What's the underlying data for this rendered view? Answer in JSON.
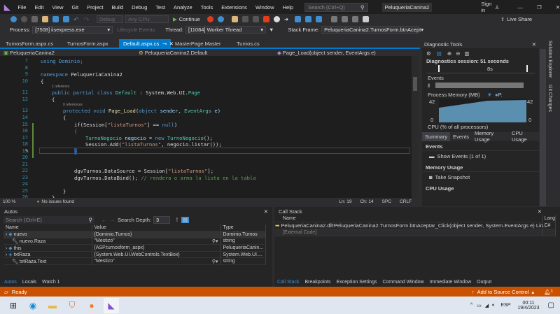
{
  "menu": {
    "items": [
      "File",
      "Edit",
      "View",
      "Git",
      "Project",
      "Build",
      "Debug",
      "Test",
      "Analyze",
      "Tools",
      "Extensions",
      "Window",
      "Help"
    ],
    "search_placeholder": "Search (Ctrl+Q)",
    "solution_title": "PeluqueriaCanina2",
    "sign_in": "Sign in"
  },
  "toolbar": {
    "config": "Debug",
    "platform": "Any CPU",
    "continue": "Continue",
    "live_share": "Live Share"
  },
  "toolbar2": {
    "process_label": "Process:",
    "process": "[7508] iisexpress.exe",
    "lifecycle": "Lifecycle Events",
    "thread_label": "Thread:",
    "thread": "[11084] Worker Thread",
    "stack_label": "Stack Frame:",
    "stack": "PeluqueriaCanina2.TurnosForm.btnAcept"
  },
  "tabs": [
    "TurnosForm.aspx.cs",
    "TurnosForm.aspx",
    "Default.aspx.cs",
    "MasterPage.Master",
    "Turnos.cs"
  ],
  "navbar": {
    "project": "PeluqueriaCanina2",
    "class": "PeluqueriaCanina2.Default",
    "member": "Page_Load(object sender, EventArgs e)"
  },
  "code": {
    "line_numbers": [
      "7",
      "8",
      "9",
      "10",
      "11",
      "12",
      "13",
      "14",
      "15",
      "16",
      "17",
      "18",
      "19",
      "20",
      "21",
      "22",
      "23",
      "24",
      "25",
      "26"
    ],
    "lens1": "1 reference",
    "lens2": "0 references",
    "l7": "using Dominio;",
    "l9a": "namespace",
    "l9b": " PeluqueriaCanina2",
    "l10": "{",
    "l11a": "public partial class ",
    "l11b": "Default",
    ": System.Web.UI.": " : System.Web.UI.",
    "l11c": " : System.Web.UI.",
    "l11d": "Page",
    "l12": "{",
    "l13a": "protected void ",
    "l13b": "Page_Load",
    "l13c": "(",
    "l13d": "object",
    " l13e": "",
    "l13f": " sender, ",
    "l13g": "EventArgs",
    "l13h": " e)",
    "l14": "{",
    "l15a": "if(Session[",
    "l15b": "\"listaTurnos\"",
    "l15c": "] == ",
    "l15d": "null",
    "l15e": ")",
    "l16": "{",
    "l17a": "TurnoNegocio",
    "l17b": " negocio = ",
    "l17c": "new ",
    "l17d": "TurnoNegocio",
    "l17e": "();",
    "l18a": "Session.Add(",
    "l18b": "\"listaTurnos\"",
    "l18c": ", negocio.listar());",
    "l19": "}",
    "l22a": "dgvTurnos.DataSource = Session[",
    "l22b": "\"listaTurnos\"",
    "l22c": "];",
    "l23a": "dgvTurnos.DataBind(); ",
    "l23b": "// rendera o arma la lista en la tabla",
    "l25": "}",
    "l26": "}"
  },
  "editor_status": {
    "zoom": "100 %",
    "issues": "No issues found",
    "ln": "Ln: 19",
    "ch": "Ch: 14",
    "spc": "SPC",
    "crlf": "CRLF"
  },
  "diagnostics": {
    "title": "Diagnostic Tools",
    "session": "Diagnostics session: 51 seconds",
    "timeline": "8s",
    "events": "Events",
    "memory": "Process Memory (MB)",
    "legend": "P.",
    "ymax": "42",
    "ymin": "0",
    "cpu": "CPU (% of all processors)",
    "tabs": [
      "Summary",
      "Events",
      "Memory Usage",
      "CPU Usage"
    ],
    "sec_events": "Events",
    "show_events": "Show Events (1 of 1)",
    "sec_memory": "Memory Usage",
    "snapshot": "Take Snapshot",
    "sec_cpu": "CPU Usage"
  },
  "side_tabs": [
    "Solution Explorer",
    "Git Changes"
  ],
  "autos": {
    "title": "Autos",
    "search_placeholder": "Search (Ctrl+E)",
    "depth_label": "Search Depth:",
    "depth": "3",
    "columns": [
      "Name",
      "Value",
      "Type"
    ],
    "rows": [
      {
        "name": "nuevo",
        "value": "{Dominio.Turnos}",
        "type": "Dominio.Turnos"
      },
      {
        "name": "nuevo.Raza",
        "value": "\"Mestizo\"",
        "type": "string"
      },
      {
        "name": "this",
        "value": "{ASP.turnosform_aspx}",
        "type": "PeluqueriaCanin..."
      },
      {
        "name": "txtRaza",
        "value": "{System.Web.UI.WebControls.TextBox}",
        "type": "System.Web.UI...."
      },
      {
        "name": "txtRaza.Text",
        "value": "\"Mestizo\"",
        "type": "string"
      }
    ],
    "tabs": [
      "Autos",
      "Locals",
      "Watch 1"
    ]
  },
  "callstack": {
    "title": "Call Stack",
    "columns": [
      "Name",
      "Lang"
    ],
    "rows": [
      {
        "name": "PeluqueriaCanina2.dll!PeluqueriaCanina2.TurnosForm.btnAceptar_Click(object sender, System.EventArgs e) Lin...",
        "lang": "C#"
      },
      {
        "name": "[External Code]",
        "lang": ""
      }
    ],
    "tabs": [
      "Call Stack",
      "Breakpoints",
      "Exception Settings",
      "Command Window",
      "Immediate Window",
      "Output"
    ]
  },
  "status": {
    "ready": "Ready",
    "source_control": "Add to Source Control",
    "notifications": "1"
  },
  "taskbar": {
    "lang": "ESP",
    "time": "00:11",
    "date": "19/4/2023"
  },
  "colors": {
    "accent": "#007acc",
    "status": "#ca5100",
    "chart": "#5a8fb0"
  }
}
